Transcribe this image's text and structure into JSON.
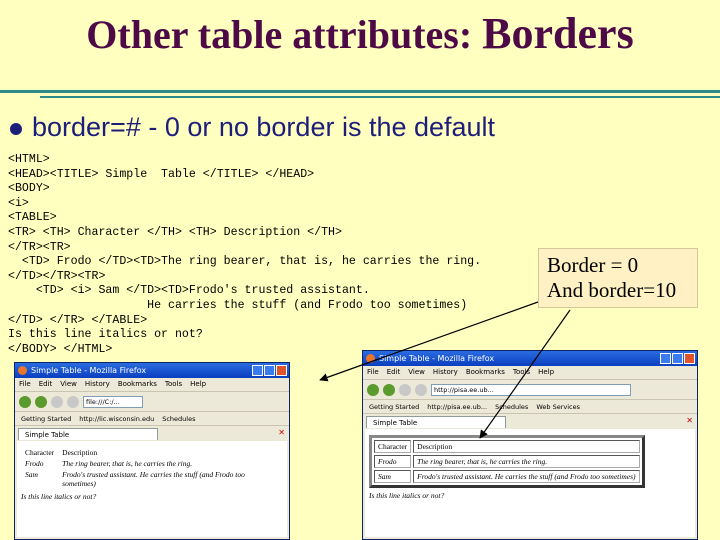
{
  "slide": {
    "title_main": "Other table attributes: ",
    "title_tail": "Borders",
    "bullet_code": "border=#",
    "bullet_dash": " - ",
    "bullet_rest": "0 or no border is the default",
    "code": "<HTML>\n<HEAD><TITLE> Simple  Table </TITLE> </HEAD>\n<BODY>\n<i>\n<TABLE>\n<TR> <TH> Character </TH> <TH> Description </TH>\n</TR><TR>\n  <TD> Frodo </TD><TD>The ring bearer, that is, he carries the ring.\n</TD></TR><TR>\n    <TD> <i> Sam </TD><TD>Frodo's trusted assistant.\n                    He carries the stuff (and Frodo too sometimes)\n</TD> </TR> </TABLE>\nIs this line italics or not?\n</BODY> </HTML>",
    "note_line1": "Border = 0",
    "note_line2": "And border=10"
  },
  "browser_left": {
    "window_title": "Simple Table - Mozilla Firefox",
    "menu": [
      "File",
      "Edit",
      "View",
      "History",
      "Bookmarks",
      "Tools",
      "Help"
    ],
    "address": "file:///C:/...",
    "bookmarks": [
      "Getting Started",
      "http://lic.wisconsin.edu",
      "Schedules"
    ],
    "tab_label": "Simple Table",
    "table": {
      "headers": [
        "Character",
        "Description"
      ],
      "rows": [
        {
          "c1": "Frodo",
          "c2": "The ring bearer, that is, he carries the ring."
        },
        {
          "c1": "Sam",
          "c2": "Frodo's trusted assistant. He carries the stuff (and Frodo too sometimes)"
        }
      ]
    },
    "after_text": "Is this line italics or not?"
  },
  "browser_right": {
    "window_title": "Simple Table - Mozilla Firefox",
    "menu": [
      "File",
      "Edit",
      "View",
      "History",
      "Bookmarks",
      "Tools",
      "Help"
    ],
    "address": "http://pisa.ee.ub...",
    "bookmarks": [
      "Getting Started",
      "http://pisa.ee.ub...",
      "Schedules",
      "Web Services"
    ],
    "tab_label": "Simple Table",
    "table": {
      "headers": [
        "Character",
        "Description"
      ],
      "rows": [
        {
          "c1": "Frodo",
          "c2": "The ring bearer, that is, he carries the ring."
        },
        {
          "c1": "Sam",
          "c2": "Frodo's trusted assistant. He carries the stuff (and Frodo too sometimes)"
        }
      ]
    },
    "after_text": "Is this line italics or not?"
  },
  "colors": {
    "background": "#ffffc0",
    "title": "#4d0a47",
    "bullet": "#1d1e7a",
    "rule": "#2e8b8b"
  }
}
